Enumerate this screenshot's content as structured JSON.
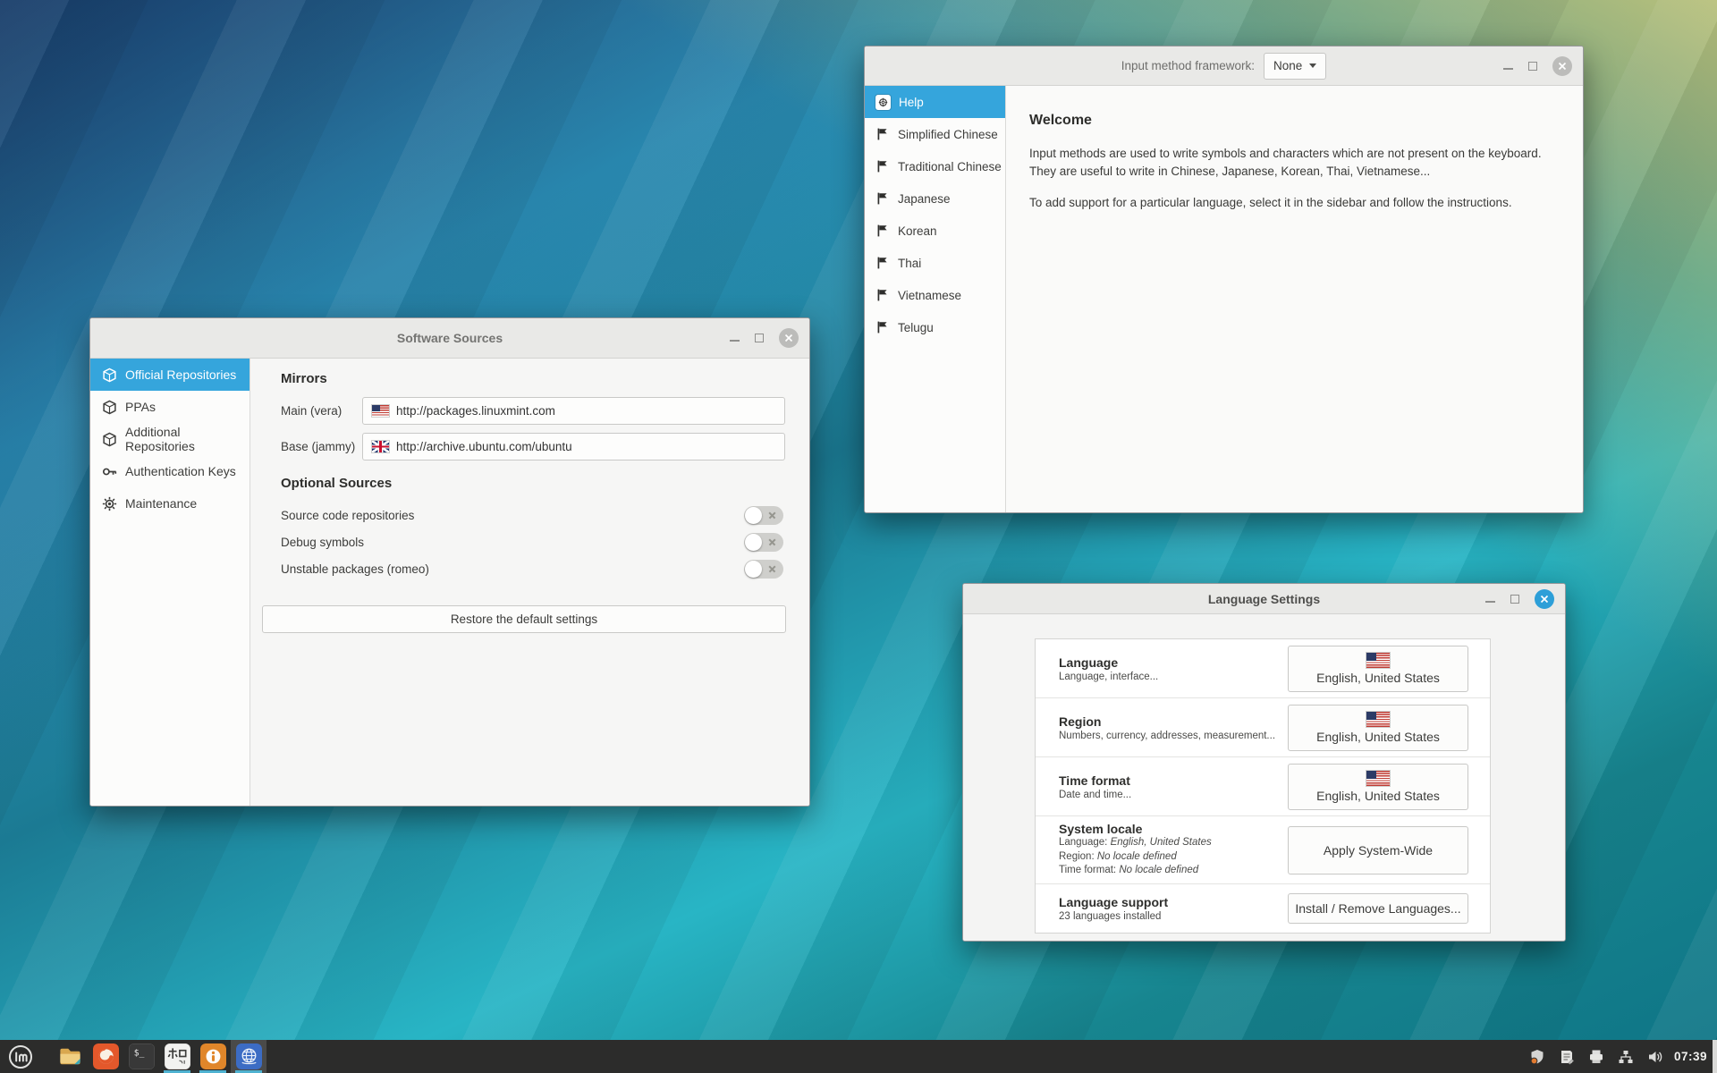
{
  "colors": {
    "accent": "#35a5dc",
    "taskbar_underline": "#4fb2d1"
  },
  "software_sources": {
    "title": "Software Sources",
    "sidebar": {
      "items": [
        {
          "label": "Official Repositories",
          "icon": "package-icon",
          "selected": true
        },
        {
          "label": "PPAs",
          "icon": "package-icon",
          "selected": false
        },
        {
          "label": "Additional Repositories",
          "icon": "package-icon",
          "selected": false
        },
        {
          "label": "Authentication Keys",
          "icon": "key-icon",
          "selected": false
        },
        {
          "label": "Maintenance",
          "icon": "gear-icon",
          "selected": false
        }
      ]
    },
    "mirrors": {
      "heading": "Mirrors",
      "main_label": "Main (vera)",
      "main_value": "http://packages.linuxmint.com",
      "main_flag": "us-flag-icon",
      "base_label": "Base (jammy)",
      "base_value": "http://archive.ubuntu.com/ubuntu",
      "base_flag": "uk-flag-icon"
    },
    "optional": {
      "heading": "Optional Sources",
      "toggles": [
        {
          "label": "Source code repositories",
          "state": "off"
        },
        {
          "label": "Debug symbols",
          "state": "off"
        },
        {
          "label": "Unstable packages (romeo)",
          "state": "off"
        }
      ]
    },
    "restore_label": "Restore the default settings"
  },
  "input_method": {
    "framework_label": "Input method framework:",
    "framework_value": "None",
    "sidebar": {
      "items": [
        {
          "label": "Help",
          "icon": "help-icon",
          "selected": true
        },
        {
          "label": "Simplified Chinese",
          "icon": "flag-icon",
          "selected": false
        },
        {
          "label": "Traditional Chinese",
          "icon": "flag-icon",
          "selected": false
        },
        {
          "label": "Japanese",
          "icon": "flag-icon",
          "selected": false
        },
        {
          "label": "Korean",
          "icon": "flag-icon",
          "selected": false
        },
        {
          "label": "Thai",
          "icon": "flag-icon",
          "selected": false
        },
        {
          "label": "Vietnamese",
          "icon": "flag-icon",
          "selected": false
        },
        {
          "label": "Telugu",
          "icon": "flag-icon",
          "selected": false
        }
      ]
    },
    "content": {
      "heading": "Welcome",
      "para1": "Input methods are used to write symbols and characters which are not present on the keyboard. They are useful to write in Chinese, Japanese, Korean, Thai, Vietnamese...",
      "para2": "To add support for a particular language, select it in the sidebar and follow the instructions."
    }
  },
  "language_settings": {
    "title": "Language Settings",
    "rows": [
      {
        "title": "Language",
        "subtitle": "Language, interface...",
        "button": "English, United States",
        "flag": "us-flag-icon"
      },
      {
        "title": "Region",
        "subtitle": "Numbers, currency, addresses, measurement...",
        "button": "English, United States",
        "flag": "us-flag-icon"
      },
      {
        "title": "Time format",
        "subtitle": "Date and time...",
        "button": "English, United States",
        "flag": "us-flag-icon"
      },
      {
        "title": "System locale",
        "line1_label": "Language:",
        "line1_value": "English, United States",
        "line2_label": "Region:",
        "line2_value": "No locale defined",
        "line3_label": "Time format:",
        "line3_value": "No locale defined",
        "button": "Apply System-Wide"
      },
      {
        "title": "Language support",
        "subtitle": "23 languages installed",
        "button": "Install / Remove Languages..."
      }
    ]
  },
  "taskbar": {
    "clock": "07:39",
    "terminal_glyph": "$_",
    "apps": [
      {
        "name": "mint-menu"
      },
      {
        "name": "file-manager"
      },
      {
        "name": "firefox"
      },
      {
        "name": "terminal"
      },
      {
        "name": "input-method",
        "open": true
      },
      {
        "name": "software-sources",
        "open": true
      },
      {
        "name": "language-settings",
        "open": true,
        "active": true
      }
    ],
    "tray": [
      "update-shield-icon",
      "report-icon",
      "printer-icon",
      "network-icon",
      "volume-icon"
    ]
  }
}
